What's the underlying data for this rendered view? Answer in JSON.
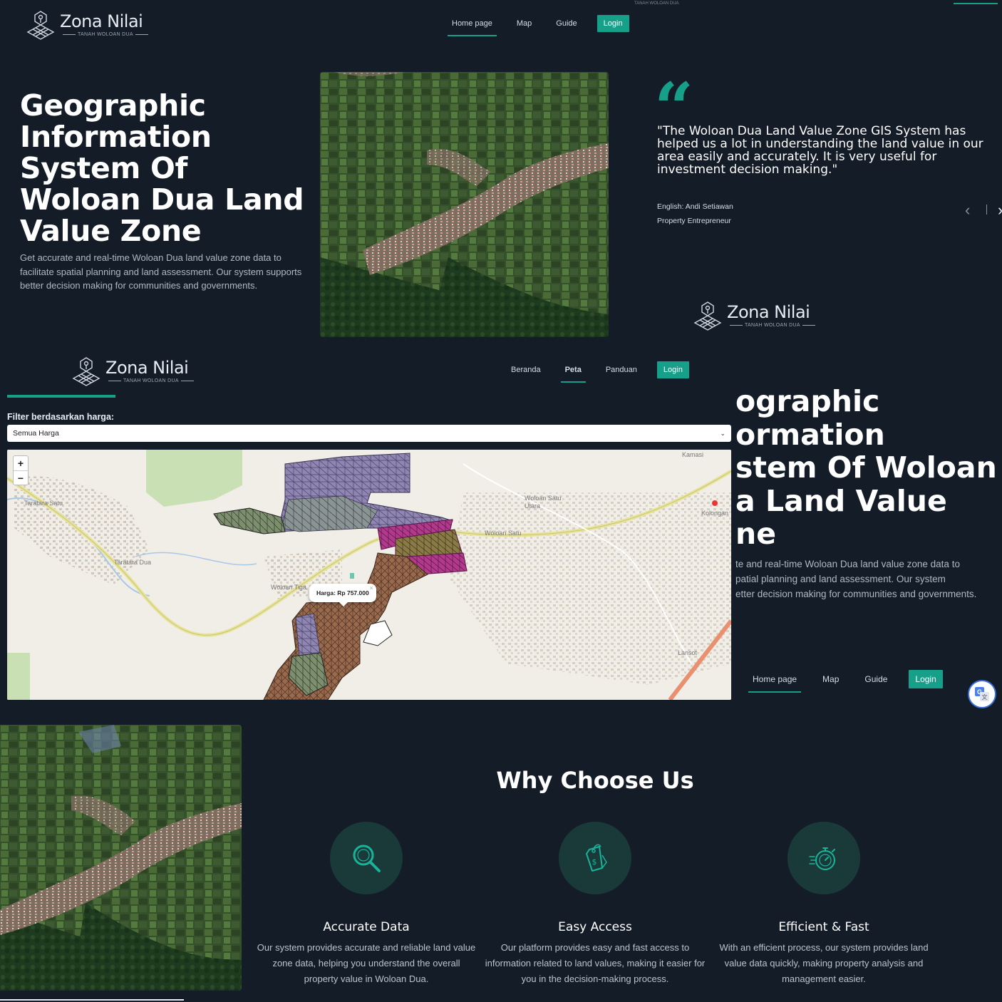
{
  "brand": {
    "name": "Zona Nilai",
    "sub": "TANAH WOLOAN DUA"
  },
  "nav_en": {
    "home": "Home page",
    "map": "Map",
    "guide": "Guide",
    "login": "Login"
  },
  "nav_id": {
    "home": "Beranda",
    "map": "Peta",
    "guide": "Panduan",
    "login": "Login"
  },
  "hero": {
    "title": "Geographic Information System Of Woloan Dua Land Value Zone",
    "description": "Get accurate and real-time Woloan Dua land value zone data to facilitate spatial planning and land assessment. Our system supports better decision making for communities and governments."
  },
  "hero_clipped": {
    "title_lines": [
      "ographic",
      "ormation",
      "stem Of Woloan",
      "a Land Value",
      "ne"
    ],
    "desc_lines": [
      "te and real-time Woloan Dua land value zone data to",
      "patial planning and land assessment. Our system",
      "etter decision making for communities and governments."
    ]
  },
  "testimonial": {
    "quote": "\"The Woloan Dua Land Value Zone GIS System has\nhelped us a lot in understanding the land value in our\narea easily and accurately. It is very useful for\ninvestment decision making.\"",
    "author": "English: Andi Setiawan",
    "role": "Property Entrepreneur"
  },
  "map_section": {
    "filter_label": "Filter berdasarkan harga:",
    "select_value": "Semua Harga",
    "popup": "Harga: Rp 757.000",
    "places": [
      "Kamasi",
      "Taratara Satu",
      "Taratara Dua",
      "Woloan Satu Utara",
      "Woloan Satu",
      "Woloan Tiga",
      "Kolongan",
      "Lansot"
    ]
  },
  "why": {
    "title": "Why Choose Us",
    "features": [
      {
        "title": "Accurate Data",
        "text": "Our system provides accurate and reliable land value zone data, helping you understand the overall property value in Woloan Dua.",
        "icon": "magnifier-icon"
      },
      {
        "title": "Easy Access",
        "text": "Our platform provides easy and fast access to information related to land values, making it easier for you in the decision-making process.",
        "icon": "price-tag-icon"
      },
      {
        "title": "Efficient & Fast",
        "text": "With an efficient process, our system provides land value data quickly, making property analysis and management easier.",
        "icon": "stopwatch-icon"
      }
    ]
  },
  "colors": {
    "bg": "#141c27",
    "accent": "#16a08a"
  }
}
